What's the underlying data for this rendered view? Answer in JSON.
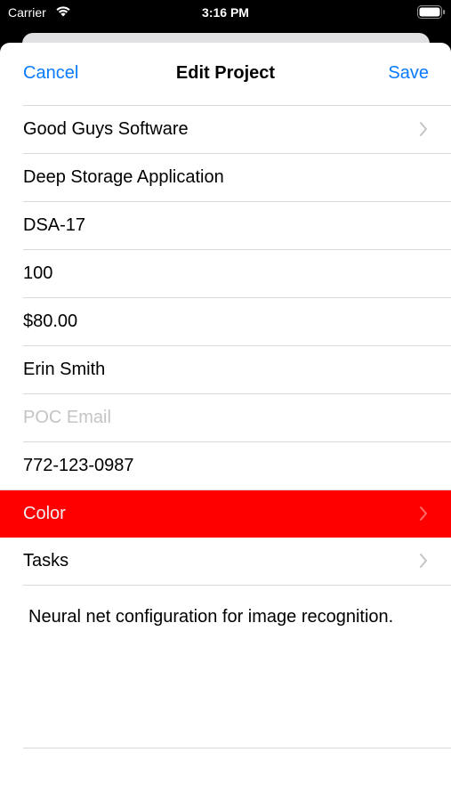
{
  "status_bar": {
    "carrier": "Carrier",
    "time": "3:16 PM",
    "wifi_icon": "wifi-icon",
    "battery_icon": "battery-icon"
  },
  "nav": {
    "cancel_label": "Cancel",
    "title": "Edit Project",
    "save_label": "Save",
    "accent_color": "#0a7aff"
  },
  "form": {
    "client": "Good Guys Software",
    "project_name": "Deep Storage Application",
    "project_code": "DSA-17",
    "hours": "100",
    "rate": "$80.00",
    "poc_name": "Erin Smith",
    "poc_email_placeholder": "POC Email",
    "poc_phone": "772-123-0987",
    "color_label": "Color",
    "color_value": "#ff0000",
    "tasks_label": "Tasks",
    "notes": "Neural net configuration for image recognition."
  }
}
